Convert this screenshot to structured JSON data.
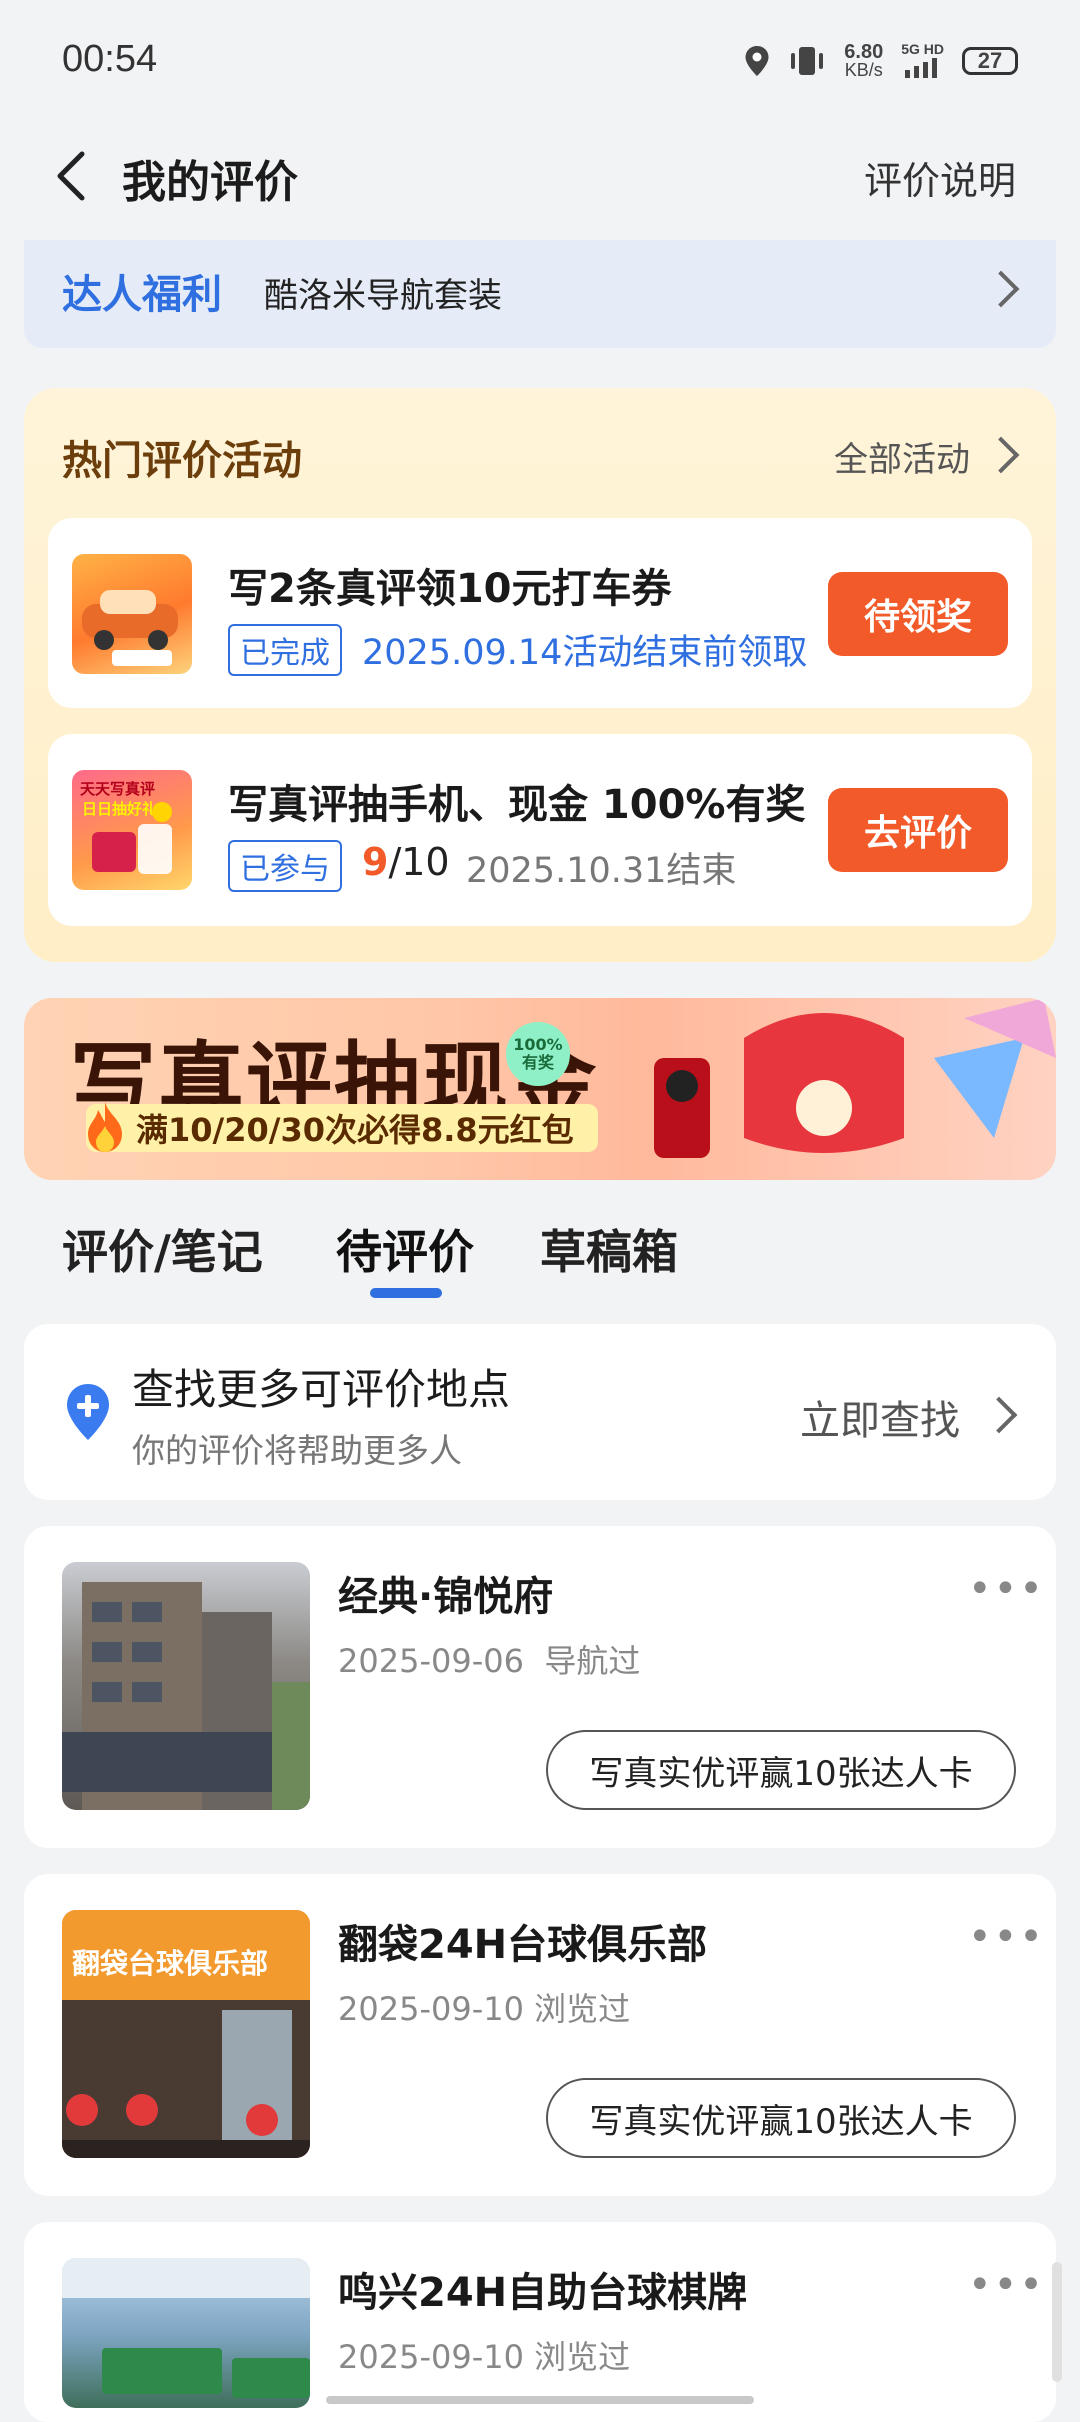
{
  "status_bar": {
    "time": "00:54",
    "net_speed_top": "6.80",
    "net_speed_bottom": "KB/s",
    "net_type": "5G HD",
    "battery": "27"
  },
  "header": {
    "title": "我的评价",
    "explain": "评价说明"
  },
  "daren": {
    "title": "达人福利",
    "subtitle": "酷洛米导航套装"
  },
  "activities": {
    "title": "热门评价活动",
    "all_label": "全部活动",
    "items": [
      {
        "title": "写2条真评领10元打车券",
        "tag": "已完成",
        "info": "2025.09.14活动结束前领取",
        "button": "待领奖"
      },
      {
        "title": "写真评抽手机、现金 100%有奖",
        "tag": "已参与",
        "progress_done": "9",
        "progress_total": "/10",
        "deadline": "2025.10.31结束",
        "button": "去评价",
        "thumb_text": "天天写真评",
        "thumb_text2": "日日抽好礼"
      }
    ]
  },
  "banner": {
    "title": "写真评抽现金",
    "badge": "100%有奖",
    "subtitle": "满10/20/30次必得8.8元红包"
  },
  "tabs": [
    {
      "label": "评价/笔记"
    },
    {
      "label": "待评价"
    },
    {
      "label": "草稿箱"
    }
  ],
  "find": {
    "title": "查找更多可评价地点",
    "subtitle": "你的评价将帮助更多人",
    "action": "立即查找"
  },
  "places": [
    {
      "name": "经典·锦悦府",
      "date": "2025-09-06",
      "action_type": "导航过",
      "button": "写真实优评赢10张达人卡"
    },
    {
      "name": "翻袋24H台球俱乐部",
      "date": "2025-09-10",
      "action_type": "浏览过",
      "button": "写真实优评赢10张达人卡",
      "sign": "翻袋台球俱乐部"
    },
    {
      "name": "鸣兴24H自助台球棋牌",
      "date": "2025-09-10",
      "action_type": "浏览过"
    }
  ],
  "colors": {
    "accent": "#2f6fe0",
    "cta": "#f25a2a",
    "activity_bg": "#fff4d9"
  }
}
